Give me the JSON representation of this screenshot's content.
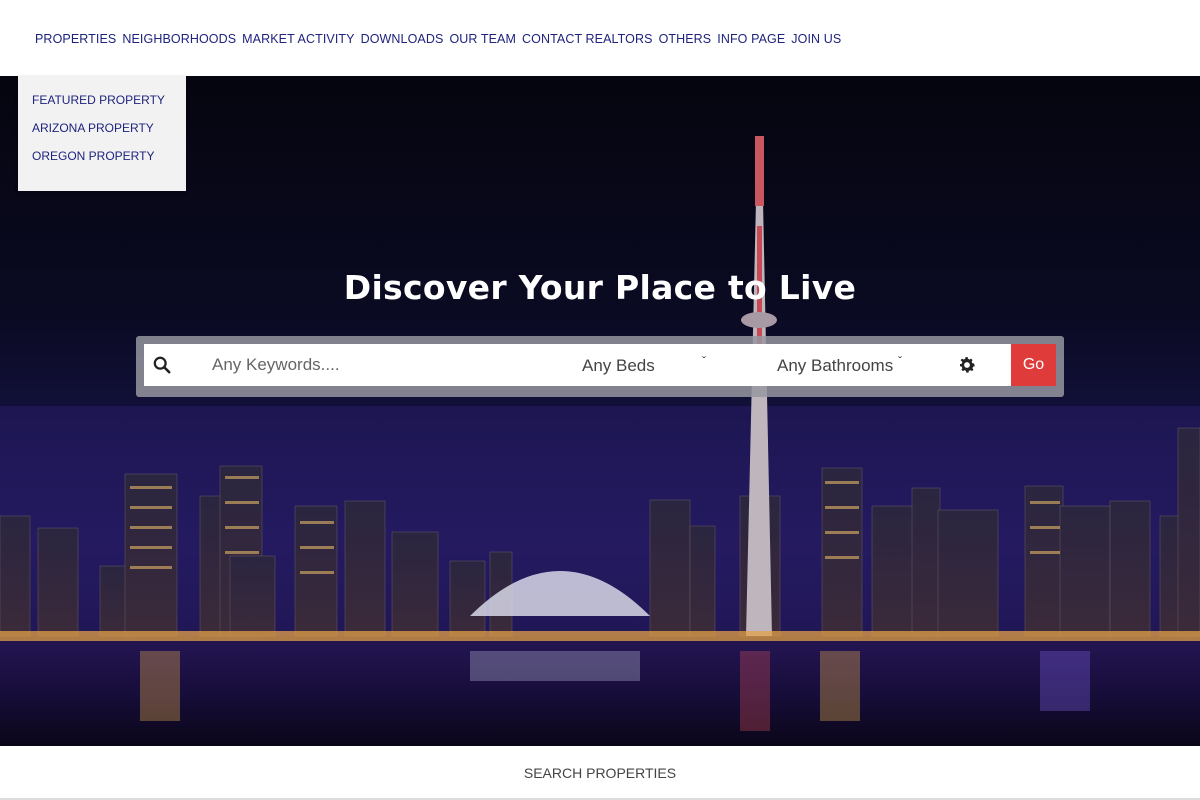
{
  "nav": {
    "items": [
      "PROPERTIES",
      "NEIGHBORHOODS",
      "MARKET ACTIVITY",
      "DOWNLOADS",
      "OUR TEAM",
      "CONTACT REALTORS",
      "OTHERS",
      "INFO PAGE",
      "JOIN US"
    ]
  },
  "dropdown": {
    "items": [
      "FEATURED PROPERTY",
      "ARIZONA PROPERTY",
      "OREGON PROPERTY"
    ]
  },
  "hero": {
    "headline": "Discover Your Place to Live"
  },
  "search": {
    "keywords_placeholder": "Any Keywords....",
    "beds_label": "Any Beds",
    "bathrooms_label": "Any Bathrooms",
    "go_label": "Go",
    "icon": "search-icon",
    "settings_icon": "gear-icon"
  },
  "footer": {
    "search_properties": "SEARCH PROPERTIES"
  },
  "colors": {
    "nav_text": "#1e237e",
    "go_button": "#df3b3b"
  }
}
